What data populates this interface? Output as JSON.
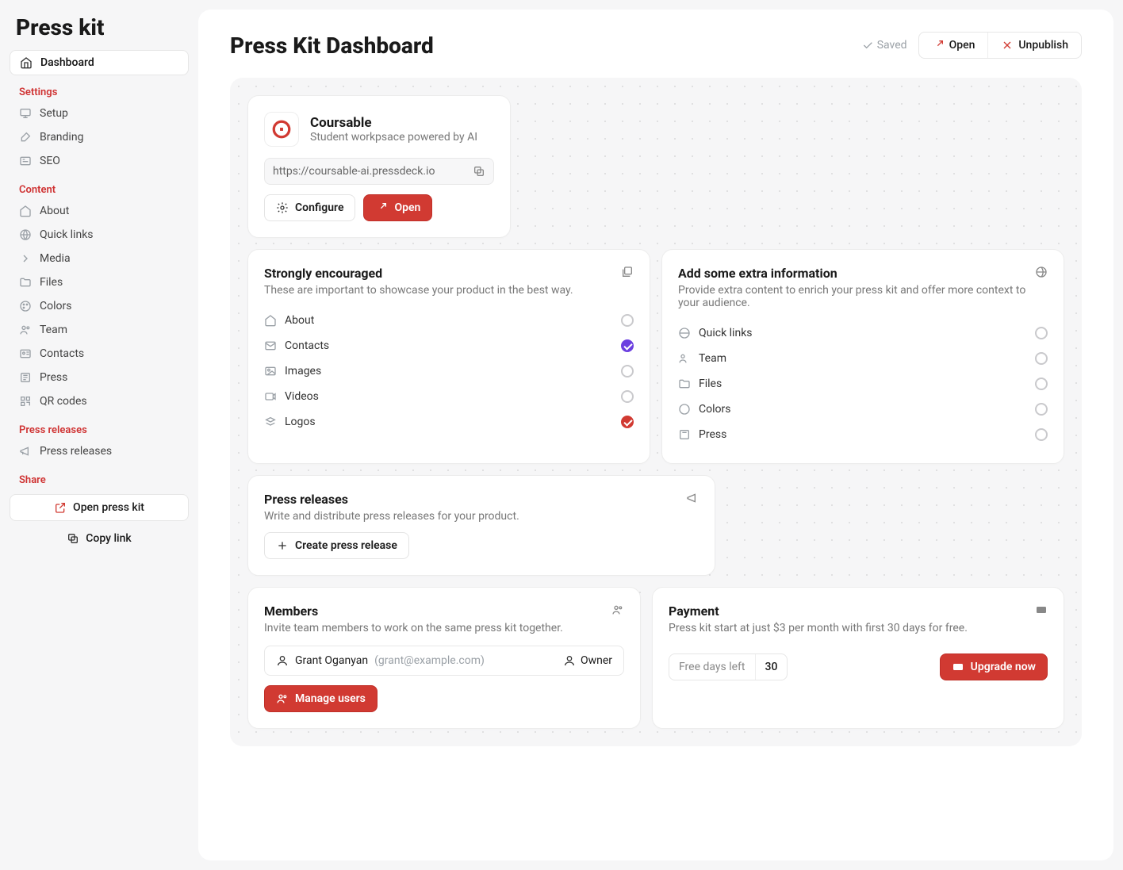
{
  "brand": "Press kit",
  "sidebar": {
    "dashboard": "Dashboard",
    "sections": {
      "settings": "Settings",
      "content": "Content",
      "press_releases": "Press releases",
      "share": "Share"
    },
    "settings": {
      "setup": "Setup",
      "branding": "Branding",
      "seo": "SEO"
    },
    "content": {
      "about": "About",
      "quick_links": "Quick links",
      "media": "Media",
      "files": "Files",
      "colors": "Colors",
      "team": "Team",
      "contacts": "Contacts",
      "press": "Press",
      "qr_codes": "QR codes"
    },
    "press_releases_item": "Press releases",
    "share": {
      "open_press_kit": "Open press kit",
      "copy_link": "Copy link"
    }
  },
  "header": {
    "title": "Press Kit Dashboard",
    "saved": "Saved",
    "open": "Open",
    "unpublish": "Unpublish"
  },
  "product": {
    "name": "Coursable",
    "subtitle": "Student workpsace powered by AI",
    "url": "https://coursable-ai.pressdeck.io",
    "configure": "Configure",
    "open": "Open"
  },
  "encouraged": {
    "title": "Strongly encouraged",
    "subtitle": "These are important to showcase your product in the best way.",
    "items": {
      "about": "About",
      "contacts": "Contacts",
      "images": "Images",
      "videos": "Videos",
      "logos": "Logos"
    }
  },
  "extra": {
    "title": "Add some extra information",
    "subtitle": "Provide extra content to enrich your press kit and offer more context to your audience.",
    "items": {
      "quick_links": "Quick links",
      "team": "Team",
      "files": "Files",
      "colors": "Colors",
      "press": "Press"
    }
  },
  "pr": {
    "title": "Press releases",
    "subtitle": "Write and distribute press releases for your product.",
    "create": "Create press release"
  },
  "members": {
    "title": "Members",
    "subtitle": "Invite team members to work on the same press kit together.",
    "name": "Grant Oganyan",
    "email": "(grant@example.com)",
    "role": "Owner",
    "manage": "Manage users"
  },
  "payment": {
    "title": "Payment",
    "subtitle": "Press kit start at just $3 per month with first 30 days for free.",
    "free_days_label": "Free days left",
    "free_days": "30",
    "upgrade": "Upgrade now"
  }
}
